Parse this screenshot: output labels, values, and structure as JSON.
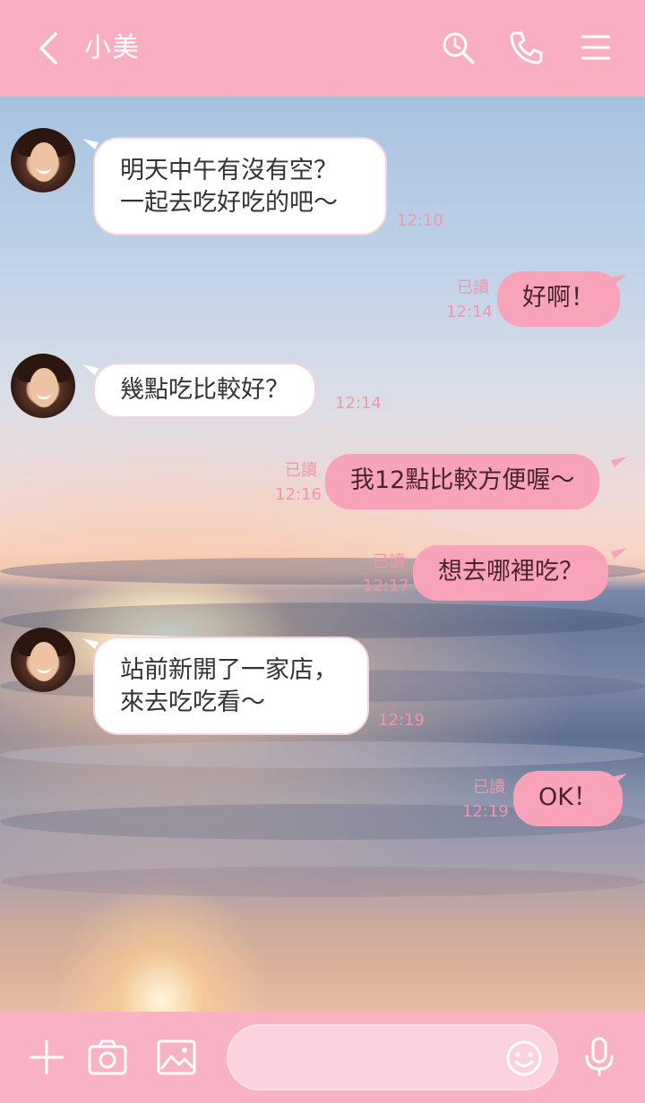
{
  "header": {
    "back_icon": "chevron-left-icon",
    "title": "小美",
    "search_icon": "search-icon",
    "call_icon": "phone-icon",
    "menu_icon": "menu-icon"
  },
  "messages": [
    {
      "side": "left",
      "lines": [
        "明天中午有沒有空？",
        "一起去吃好吃的吧～"
      ],
      "time": "12:10"
    },
    {
      "side": "right",
      "lines": [
        "好啊！"
      ],
      "read": "已讀",
      "time": "12:14"
    },
    {
      "side": "left",
      "lines": [
        "幾點吃比較好？"
      ],
      "time": "12:14"
    },
    {
      "side": "right",
      "lines": [
        "我12點比較方便喔～"
      ],
      "read": "已讀",
      "time": "12:16"
    },
    {
      "side": "right",
      "lines": [
        "想去哪裡吃？"
      ],
      "read": "已讀",
      "time": "12:17"
    },
    {
      "side": "left",
      "lines": [
        "站前新開了一家店，",
        "來去吃吃看～"
      ],
      "time": "12:19"
    },
    {
      "side": "right",
      "lines": [
        "OK！"
      ],
      "read": "已讀",
      "time": "12:19"
    }
  ],
  "footer": {
    "add_icon": "plus-icon",
    "camera_icon": "camera-icon",
    "image_icon": "image-icon",
    "input_placeholder": "",
    "emoji_icon": "smiley-icon",
    "mic_icon": "microphone-icon"
  },
  "colors": {
    "header_bg": "#f9afc1",
    "bubble_right": "#f9a3bb",
    "bubble_left": "#ffffff",
    "meta_text": "#f295ad"
  }
}
